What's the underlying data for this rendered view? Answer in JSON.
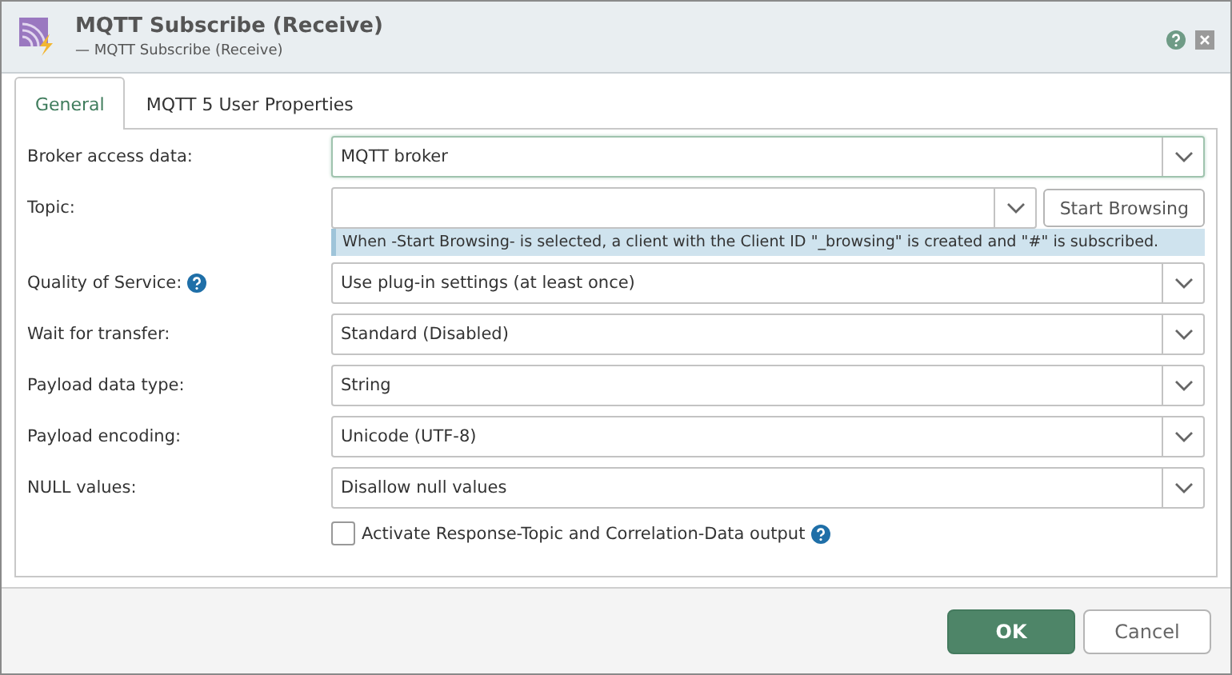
{
  "window": {
    "title": "MQTT Subscribe (Receive)",
    "subtitle": "— MQTT Subscribe (Receive)"
  },
  "tabs": [
    {
      "label": "General",
      "selected": true
    },
    {
      "label": "MQTT 5 User Properties",
      "selected": false
    }
  ],
  "fields": [
    {
      "kind": "select",
      "label": "Broker access data:",
      "value": "MQTT broker",
      "focused": true,
      "help": false
    },
    {
      "kind": "combo",
      "label": "Topic:",
      "focused": false,
      "help": false,
      "button": "Start Browsing",
      "hint": "When -Start Browsing- is selected, a client with the Client ID \"_browsing\" is created and \"#\" is subscribed."
    },
    {
      "kind": "select",
      "label": "Quality of Service:",
      "value": "Use plug-in settings (at least once)",
      "focused": false,
      "help": true
    },
    {
      "kind": "select",
      "label": "Wait for transfer:",
      "value": "Standard (Disabled)",
      "focused": false,
      "help": false
    },
    {
      "kind": "select",
      "label": "Payload data type:",
      "value": "String",
      "focused": false,
      "help": false
    },
    {
      "kind": "select",
      "label": "Payload encoding:",
      "value": "Unicode (UTF-8)",
      "focused": false,
      "help": false
    },
    {
      "kind": "select",
      "label": "NULL values:",
      "value": "Disallow null values",
      "focused": false,
      "help": false
    }
  ],
  "checkbox": {
    "label": "Activate Response-Topic and Correlation-Data output",
    "checked": false,
    "help": true
  },
  "buttons": [
    {
      "label": "OK",
      "kind": "primary"
    },
    {
      "label": "Cancel",
      "kind": "secondary"
    }
  ]
}
